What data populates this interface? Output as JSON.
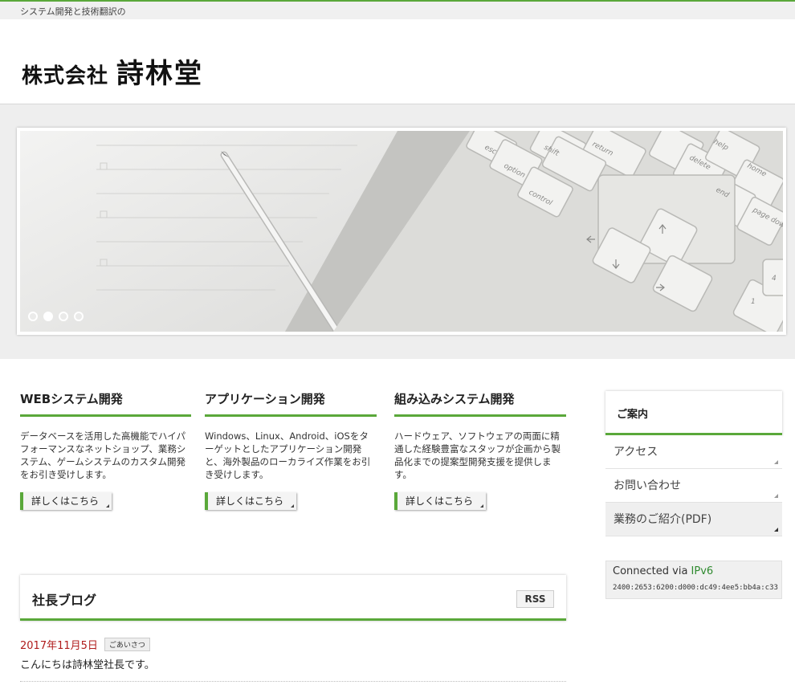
{
  "site": {
    "tagline": "システム開発と技術翻訳の",
    "company_prefix": "株式会社",
    "company_name": "詩林堂"
  },
  "slider": {
    "slide_count": 4,
    "active_index": 1,
    "key_labels": [
      "esc",
      "shift",
      "option",
      "control",
      "return",
      "help",
      "home",
      "delete",
      "end",
      "page down",
      "4",
      "1"
    ]
  },
  "services": [
    {
      "title": "WEBシステム開発",
      "text": "データベースを活用した高機能でハイパフォーマンスなネットショップ、業務システム、ゲームシステムのカスタム開発をお引き受けします。",
      "button": "詳しくはこちら"
    },
    {
      "title": "アプリケーション開発",
      "text": "Windows、Linux、Android、iOSをターゲットとしたアプリケーション開発と、海外製品のローカライズ作業をお引き受けします。",
      "button": "詳しくはこちら"
    },
    {
      "title": "組み込みシステム開発",
      "text": "ハードウェア、ソフトウェアの両面に精通した経験豊富なスタッフが企画から製品化までの提案型開発支援を提供します。",
      "button": "詳しくはこちら"
    }
  ],
  "blog": {
    "title": "社長ブログ",
    "rss_label": "RSS",
    "post": {
      "date": "2017年11月5日",
      "tag": "ごあいさつ",
      "title": "こんにちは詩林堂社長です。"
    }
  },
  "sidebar": {
    "heading": "ご案内",
    "items": [
      {
        "label": "アクセス"
      },
      {
        "label": "お問い合わせ"
      },
      {
        "label": "業務のご紹介(PDF)"
      }
    ],
    "connection": {
      "prefix": "Connected via ",
      "protocol": "IPv6",
      "address": "2400:2653:6200:d000:dc49:4ee5:bb4a:c33"
    }
  },
  "colors": {
    "accent": "#5aa83a",
    "date_red": "#b01c1c",
    "ipv6_green": "#2f8a2f"
  }
}
